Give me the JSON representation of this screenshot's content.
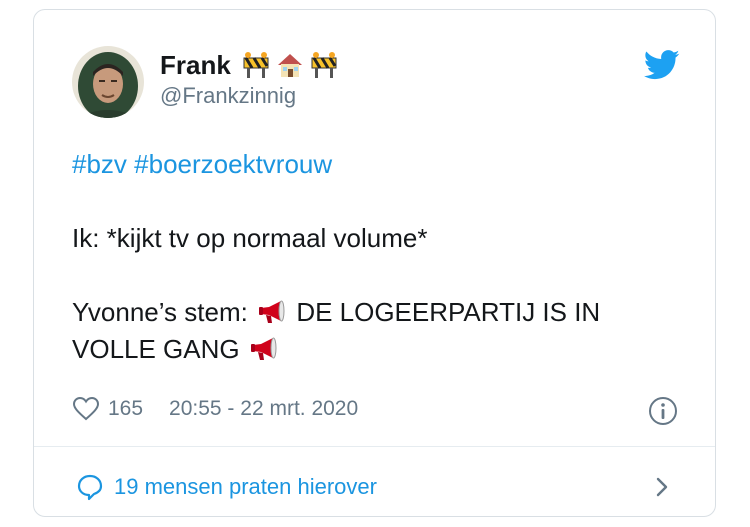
{
  "author": {
    "name": "Frank",
    "handle": "@Frankzinnig",
    "name_emojis": [
      "construction-barrier",
      "house",
      "construction-barrier"
    ]
  },
  "tweet": {
    "hashtags": [
      "#bzv",
      "#boerzoektvrouw"
    ],
    "line2": "Ik: *kijkt tv op normaal volume*",
    "line3_prefix": "Yvonne’s stem:",
    "line3_suffix": "DE LOGEERPARTIJ IS IN",
    "line4": "VOLLE GANG"
  },
  "meta": {
    "likes": "165",
    "timestamp": "20:55 - 22 mrt. 2020"
  },
  "conversation": {
    "label": "19 mensen praten hierover"
  },
  "colors": {
    "link": "#1b95e0",
    "secondary_text": "#657786",
    "border": "#d9dfe4"
  }
}
